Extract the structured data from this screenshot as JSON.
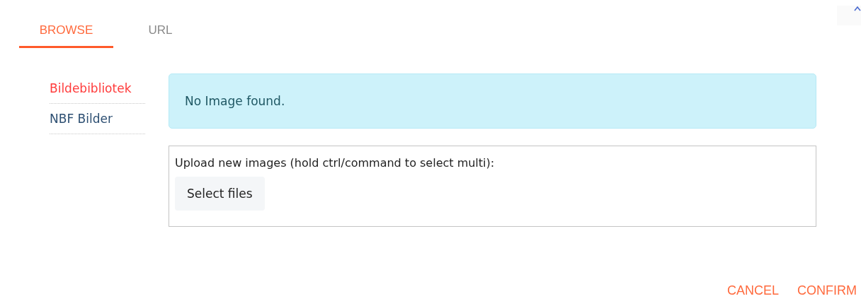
{
  "tabs": [
    {
      "label": "BROWSE",
      "selected": true
    },
    {
      "label": "URL",
      "selected": false
    }
  ],
  "sidebar": {
    "items": [
      {
        "label": "Bildebibliotek",
        "selected": true
      },
      {
        "label": "NBF Bilder",
        "selected": false
      }
    ]
  },
  "alert": {
    "text": "No Image found."
  },
  "upload": {
    "label": "Upload new images (hold ctrl/command to select multi):",
    "button": "Select files"
  },
  "footer": {
    "buttons": [
      "CANCEL",
      "CONFIRM"
    ]
  }
}
